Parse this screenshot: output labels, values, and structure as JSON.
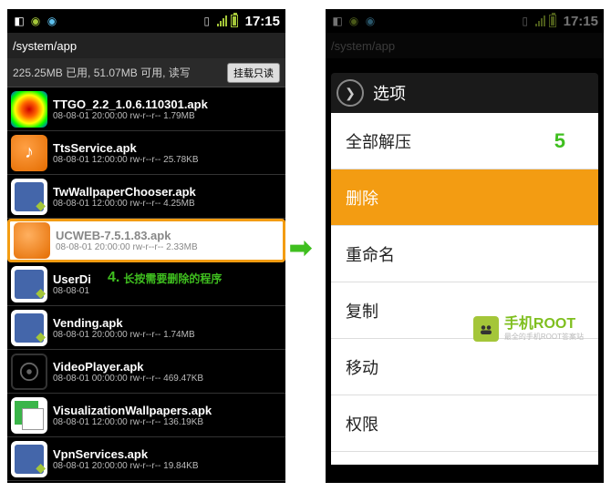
{
  "status": {
    "time": "17:15"
  },
  "path": "/system/app",
  "storage": {
    "text": "225.25MB 已用, 51.07MB 可用, 读写",
    "mountBtn": "挂载只读"
  },
  "files": [
    {
      "name": "TTGO_2.2_1.0.6.110301.apk",
      "meta": "08-08-01 20:00:00  rw-r--r--  1.79MB",
      "icon": "ttgo"
    },
    {
      "name": "TtsService.apk",
      "meta": "08-08-01 12:00:00  rw-r--r--  25.78KB",
      "icon": "tts"
    },
    {
      "name": "TwWallpaperChooser.apk",
      "meta": "08-08-01 12:00:00  rw-r--r--  4.25MB",
      "icon": "apk"
    },
    {
      "name": "UCWEB-7.5.1.83.apk",
      "meta": "08-08-01 20:00:00  rw-r--r--  2.33MB",
      "icon": "uc",
      "highlight": true
    },
    {
      "name": "UserDi",
      "meta": "08-08-01",
      "icon": "apk",
      "annot4": true
    },
    {
      "name": "Vending.apk",
      "meta": "08-08-01 20:00:00  rw-r--r--  1.74MB",
      "icon": "apk"
    },
    {
      "name": "VideoPlayer.apk",
      "meta": "08-08-01 00:00:00  rw-r--r--  469.47KB",
      "icon": "video"
    },
    {
      "name": "VisualizationWallpapers.apk",
      "meta": "08-08-01 12:00:00  rw-r--r--  136.19KB",
      "icon": "visual"
    },
    {
      "name": "VpnServices.apk",
      "meta": "08-08-01 20:00:00  rw-r--r--  19.84KB",
      "icon": "apk"
    }
  ],
  "annot4": {
    "num": "4.",
    "text": "长按需要删除的程序"
  },
  "opts": {
    "title": "选项",
    "items": [
      {
        "label": "全部解压",
        "annot5": true
      },
      {
        "label": "删除",
        "selected": true
      },
      {
        "label": "重命名"
      },
      {
        "label": "复制"
      },
      {
        "label": "移动"
      },
      {
        "label": "权限"
      }
    ]
  },
  "annot5": "5",
  "watermark": {
    "big": "手机ROOT",
    "small": "最全的手机ROOT答案站"
  }
}
